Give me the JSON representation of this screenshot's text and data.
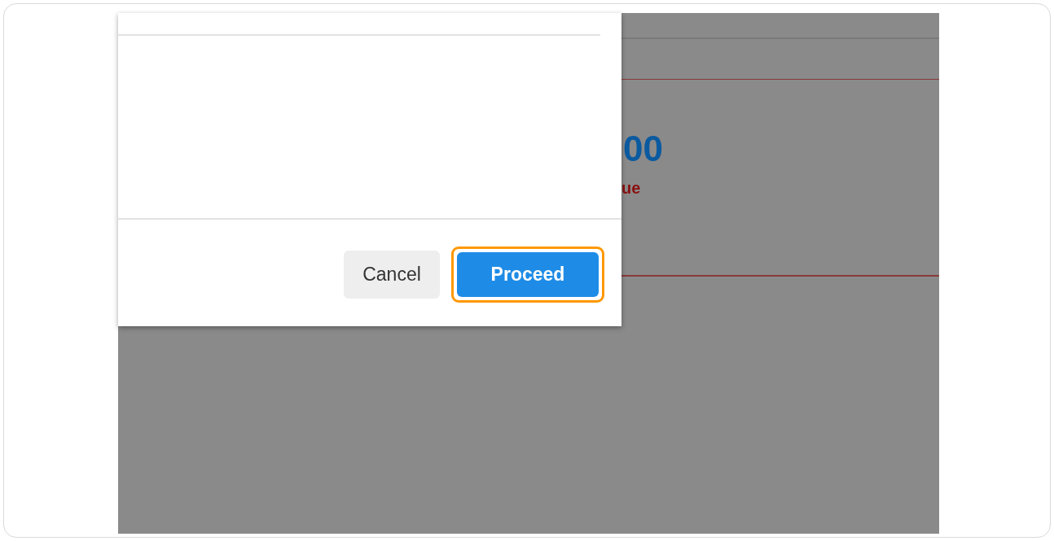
{
  "background": {
    "amount": "00",
    "note": "ue"
  },
  "dialog": {
    "buttons": [
      {
        "label": "Cancel",
        "kind": "secondary",
        "highlighted": false
      },
      {
        "label": "Proceed",
        "kind": "primary",
        "highlighted": true
      }
    ]
  }
}
